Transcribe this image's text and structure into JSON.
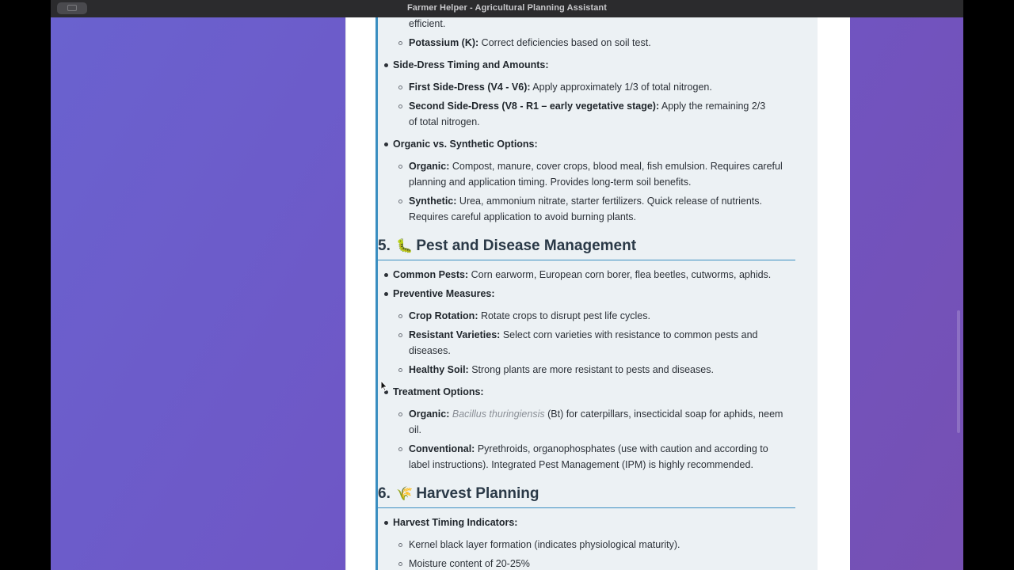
{
  "window": {
    "title": "Farmer Helper - Agricultural Planning Assistant"
  },
  "content": {
    "top_fragment": "efficient.",
    "potassium": {
      "label": "Potassium (K):",
      "text": " Correct deficiencies based on soil test."
    },
    "side_dress": {
      "label": "Side-Dress Timing and Amounts:",
      "first": {
        "label": "First Side-Dress (V4 - V6):",
        "text": " Apply approximately 1/3 of total nitrogen."
      },
      "second": {
        "label": "Second Side-Dress (V8 - R1 – early vegetative stage):",
        "text": " Apply the remaining 2/3",
        "text2": "of total nitrogen."
      }
    },
    "organic_synthetic": {
      "label": "Organic vs. Synthetic Options:",
      "organic": {
        "label": "Organic:",
        "text": " Compost, manure, cover crops, blood meal, fish emulsion. Requires careful",
        "text2": "planning and application timing. Provides long-term soil benefits."
      },
      "synthetic": {
        "label": "Synthetic:",
        "text": " Urea, ammonium nitrate, starter fertilizers. Quick release of nutrients.",
        "text2": "Requires careful application to avoid burning plants."
      }
    },
    "section5": {
      "number": "5.",
      "icon": "🐛",
      "title": "Pest and Disease Management",
      "common_pests": {
        "label": "Common Pests:",
        "text": " Corn earworm, European corn borer, flea beetles, cutworms, aphids."
      },
      "preventive": {
        "label": "Preventive Measures:",
        "crop_rotation": {
          "label": "Crop Rotation:",
          "text": " Rotate crops to disrupt pest life cycles."
        },
        "resistant": {
          "label": "Resistant Varieties:",
          "text": " Select corn varieties with resistance to common pests and",
          "text2": "diseases."
        },
        "healthy_soil": {
          "label": "Healthy Soil:",
          "text": " Strong plants are more resistant to pests and diseases."
        }
      },
      "treatment": {
        "label": "Treatment Options:",
        "organic": {
          "label": "Organic:",
          "italic": "Bacillus thuringiensis",
          "text": " (Bt) for caterpillars, insecticidal soap for aphids, neem",
          "text2": "oil."
        },
        "conventional": {
          "label": "Conventional:",
          "text": " Pyrethroids, organophosphates (use with caution and according to",
          "text2": "label instructions). Integrated Pest Management (IPM) is highly recommended."
        }
      }
    },
    "section6": {
      "number": "6.",
      "icon": "🌾",
      "title": "Harvest Planning",
      "timing": {
        "label": "Harvest Timing Indicators:",
        "black_layer": "Kernel black layer formation (indicates physiological maturity).",
        "moisture": "Moisture content of 20-25%"
      }
    }
  },
  "colors": {
    "accent": "#3a8ec1",
    "card_bg": "#ecf1f4",
    "heading": "#2a3947"
  }
}
